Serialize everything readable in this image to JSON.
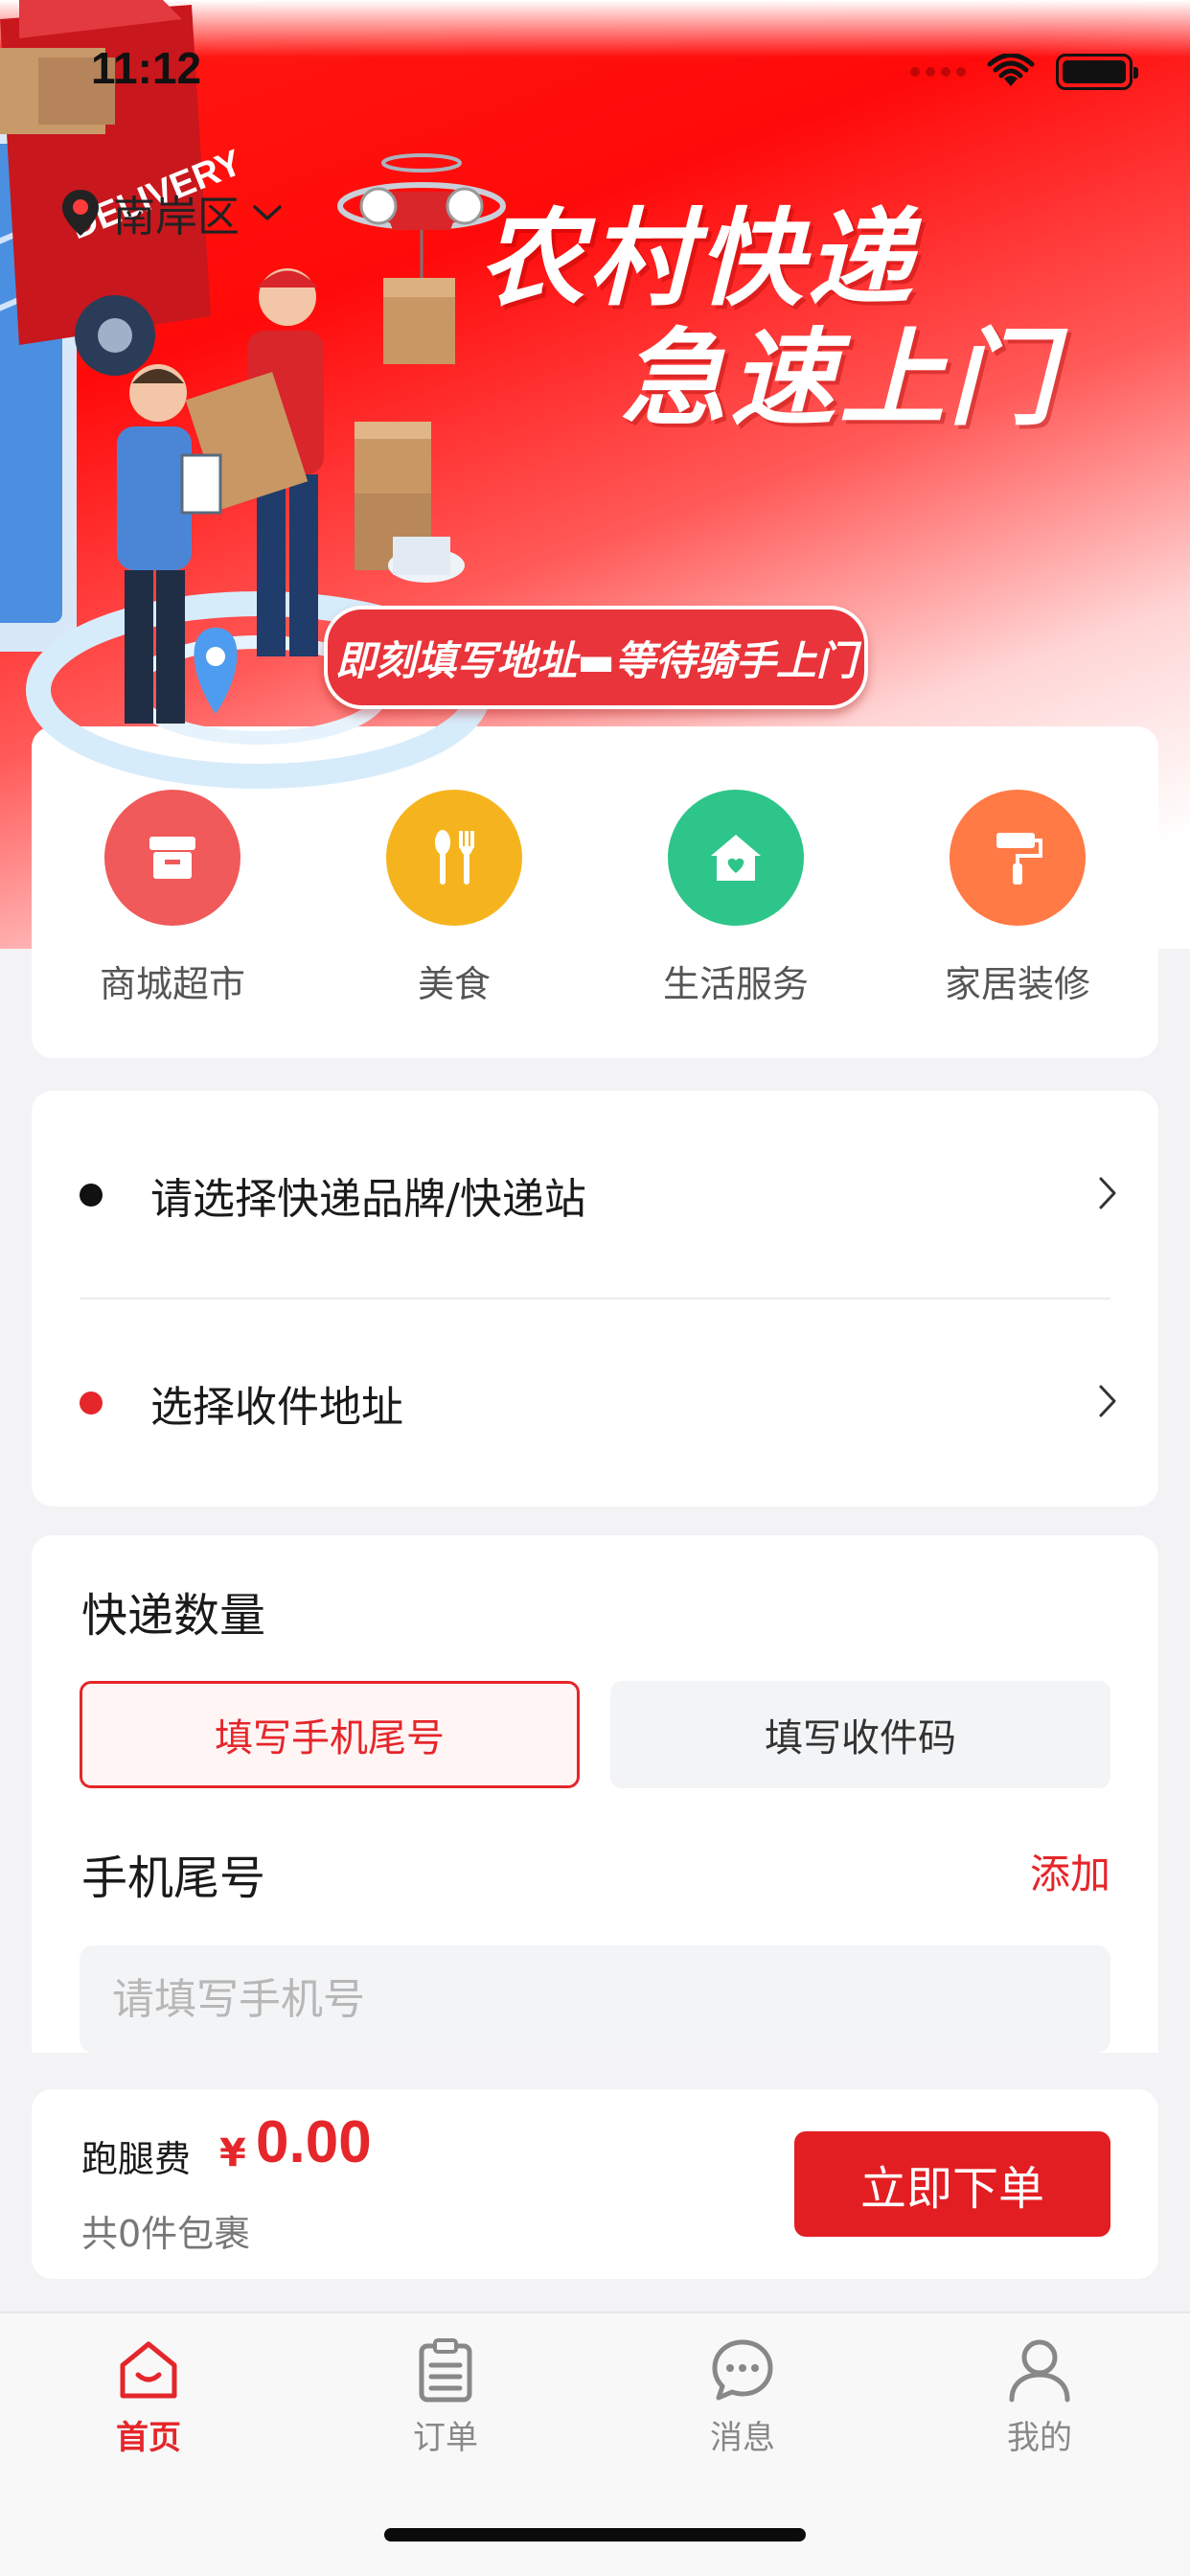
{
  "status_bar": {
    "time": "11:12"
  },
  "location": {
    "district": "南岸区"
  },
  "hero": {
    "title_line1": "农村快递",
    "title_line2": "急速上门",
    "slogan": "即刻填写地址▬等待骑手上门",
    "truck_text": "DELIVERY"
  },
  "categories": [
    {
      "label": "商城超市",
      "icon": "store-icon",
      "color": "#f05a5a"
    },
    {
      "label": "美食",
      "icon": "utensils-icon",
      "color": "#f5b41e"
    },
    {
      "label": "生活服务",
      "icon": "home-heart-icon",
      "color": "#2ec58a"
    },
    {
      "label": "家居装修",
      "icon": "paint-roller-icon",
      "color": "#ff7a45"
    }
  ],
  "select": {
    "brand_label": "请选择快递品牌/快递站",
    "address_label": "选择收件地址",
    "brand_dot_color": "#111111",
    "address_dot_color": "#e5262a"
  },
  "quantity": {
    "title": "快递数量",
    "mode_phone": "填写手机尾号",
    "mode_code": "填写收件码",
    "phone_title": "手机尾号",
    "add_label": "添加",
    "phone_placeholder": "请填写手机号"
  },
  "order": {
    "fee_label": "跑腿费",
    "currency": "¥",
    "amount": "0.00",
    "package_count": "共0件包裹",
    "submit_label": "立即下单"
  },
  "tabs": [
    {
      "label": "首页",
      "icon": "home-icon",
      "active": true
    },
    {
      "label": "订单",
      "icon": "clipboard-icon",
      "active": false
    },
    {
      "label": "消息",
      "icon": "chat-bubble-icon",
      "active": false
    },
    {
      "label": "我的",
      "icon": "user-icon",
      "active": false
    }
  ],
  "colors": {
    "primary": "#e5262a",
    "background": "#f3f3f5"
  }
}
